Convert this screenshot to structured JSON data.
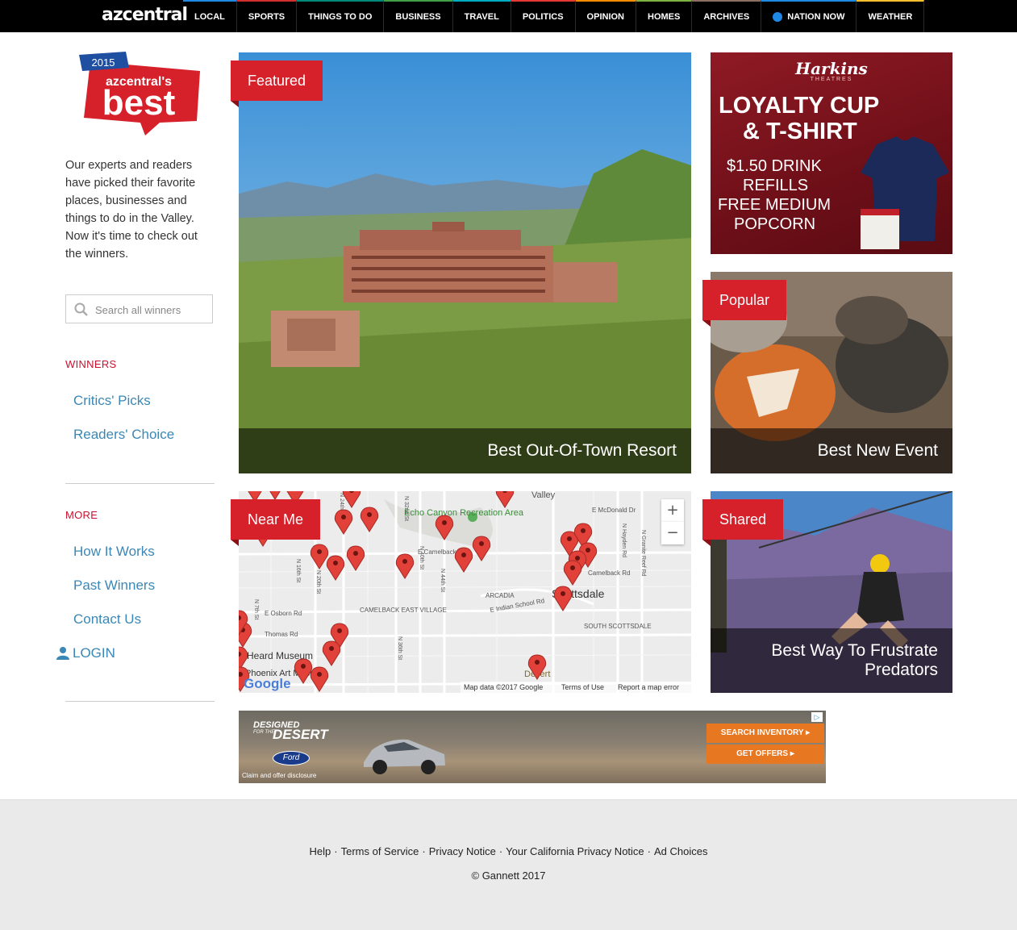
{
  "nav": {
    "logo": "azcentral",
    "items": [
      {
        "label": "LOCAL",
        "color": "#1e88e5"
      },
      {
        "label": "SPORTS",
        "color": "#d32f2f"
      },
      {
        "label": "THINGS TO DO",
        "color": "#00897b"
      },
      {
        "label": "BUSINESS",
        "color": "#43a047"
      },
      {
        "label": "TRAVEL",
        "color": "#00acc1"
      },
      {
        "label": "POLITICS",
        "color": "#e53935"
      },
      {
        "label": "OPINION",
        "color": "#fb8c00"
      },
      {
        "label": "HOMES",
        "color": "#7cb342"
      },
      {
        "label": "ARCHIVES",
        "color": "#8d6e63"
      },
      {
        "label": "NATION NOW",
        "color": "#1e88e5"
      },
      {
        "label": "WEATHER",
        "color": "#fbc02d"
      }
    ]
  },
  "badge": {
    "year": "2015",
    "brand": "azcentral's",
    "word": "best"
  },
  "sidebar": {
    "intro": "Our experts and readers have picked their favorite places, businesses and things to do in the Valley. Now it's time to check out the winners.",
    "search_placeholder": "Search all winners",
    "winners_heading": "WINNERS",
    "winners_links": [
      "Critics' Picks",
      "Readers' Choice"
    ],
    "more_heading": "MORE",
    "more_links": [
      "How It Works",
      "Past Winners",
      "Contact Us"
    ],
    "login": "LOGIN"
  },
  "tiles": {
    "featured": {
      "tag": "Featured",
      "caption": "Best Out-Of-Town Resort"
    },
    "popular": {
      "tag": "Popular",
      "caption": "Best New Event"
    },
    "nearme": {
      "tag": "Near Me"
    },
    "shared": {
      "tag": "Shared",
      "caption_line1": "Best Way To Frustrate",
      "caption_line2": "Predators"
    }
  },
  "map": {
    "labels": [
      "Valley",
      "Echo Canyon Recreation Area",
      "E McDonald Dr",
      "E Camelback Rd",
      "Camelback Rd",
      "ARCADIA",
      "E Indian School Rd",
      "Scottsdale",
      "SOUTH SCOTTSDALE",
      "CAMELBACK EAST VILLAGE",
      "E Osborn Rd",
      "Thomas Rd",
      "Heard Museum",
      "Phoenix Art Museum",
      "N 32nd St",
      "N 40th St",
      "N 44th St",
      "N 24th St",
      "N 20th St",
      "N 16th St",
      "N 7th St",
      "N 36th St",
      "N Hayden Rd",
      "N Granite Reef Rd",
      "Desert"
    ],
    "attribution": "Map data ©2017 Google",
    "terms": "Terms of Use",
    "report": "Report a map error",
    "google": "Google",
    "zoom_in": "+",
    "zoom_out": "−"
  },
  "ad_harkins": {
    "brand": "Harkins",
    "sub": "THEATRES",
    "line1": "LOYALTY CUP",
    "line2": "& T-SHIRT",
    "line3": "$1.50 DRINK",
    "line4": "REFILLS",
    "line5": "FREE MEDIUM",
    "line6": "POPCORN"
  },
  "ad_ford": {
    "line1": "DESIGNED",
    "line2": "FOR THE",
    "line3": "DESERT",
    "brand": "Ford",
    "disclosure": "Claim and offer disclosure",
    "btn1": "SEARCH INVENTORY",
    "btn2": "GET OFFERS"
  },
  "footer": {
    "links": [
      "Help",
      "Terms of Service",
      "Privacy Notice",
      "Your California Privacy Notice",
      "Ad Choices"
    ],
    "copyright": "© Gannett 2017"
  }
}
